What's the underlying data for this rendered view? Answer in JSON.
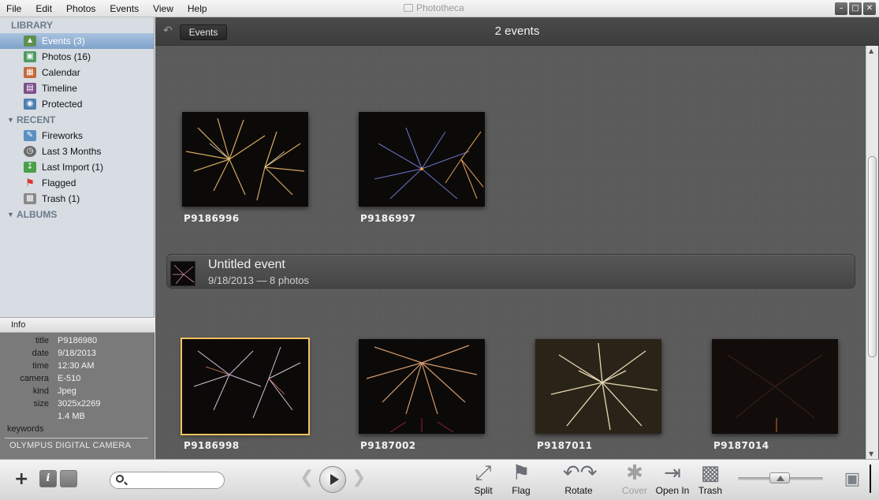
{
  "menu": [
    "File",
    "Edit",
    "Photos",
    "Events",
    "View",
    "Help"
  ],
  "window": {
    "title": "Phototheca"
  },
  "sidebar": {
    "library_label": "LIBRARY",
    "library": [
      {
        "label": "Events (3)",
        "icon": "events-icon",
        "selected": true
      },
      {
        "label": "Photos (16)",
        "icon": "photos-icon"
      },
      {
        "label": "Calendar",
        "icon": "calendar-icon"
      },
      {
        "label": "Timeline",
        "icon": "timeline-icon"
      },
      {
        "label": "Protected",
        "icon": "protected-icon"
      }
    ],
    "recent_label": "RECENT",
    "recent": [
      {
        "label": "Fireworks",
        "icon": "album-edit-icon"
      },
      {
        "label": "Last 3 Months",
        "icon": "clock-icon"
      },
      {
        "label": "Last Import (1)",
        "icon": "import-icon"
      },
      {
        "label": "Flagged",
        "icon": "flag-icon"
      },
      {
        "label": "Trash (1)",
        "icon": "trash-icon"
      }
    ],
    "albums_label": "ALBUMS"
  },
  "info": {
    "header": "Info",
    "rows": [
      {
        "key": "title",
        "value": "P9186980"
      },
      {
        "key": "date",
        "value": "9/18/2013"
      },
      {
        "key": "time",
        "value": "12:30 AM"
      },
      {
        "key": "camera",
        "value": "E-510"
      },
      {
        "key": "kind",
        "value": "Jpeg"
      },
      {
        "key": "size",
        "value": "3025x2269"
      },
      {
        "key": "",
        "value": "1.4 MB"
      }
    ],
    "keywords_label": "keywords",
    "description": "OLYMPUS DIGITAL CAMERA"
  },
  "main": {
    "back_button": "Events",
    "event_count": "2 events",
    "first_event_photos": [
      {
        "title": "P9186996"
      },
      {
        "title": "P9186997"
      }
    ],
    "event": {
      "title": "Untitled event",
      "subtitle": "9/18/2013 — 8 photos"
    },
    "second_event_photos": [
      {
        "title": "P9186998",
        "selected": true
      },
      {
        "title": "P9187002"
      },
      {
        "title": "P9187011"
      },
      {
        "title": "P9187014"
      }
    ]
  },
  "toolbar": {
    "search_placeholder": "",
    "tools": [
      "Split",
      "Flag",
      "Rotate",
      "Cover",
      "Open In",
      "Trash"
    ],
    "zoom_level": 0.5
  }
}
